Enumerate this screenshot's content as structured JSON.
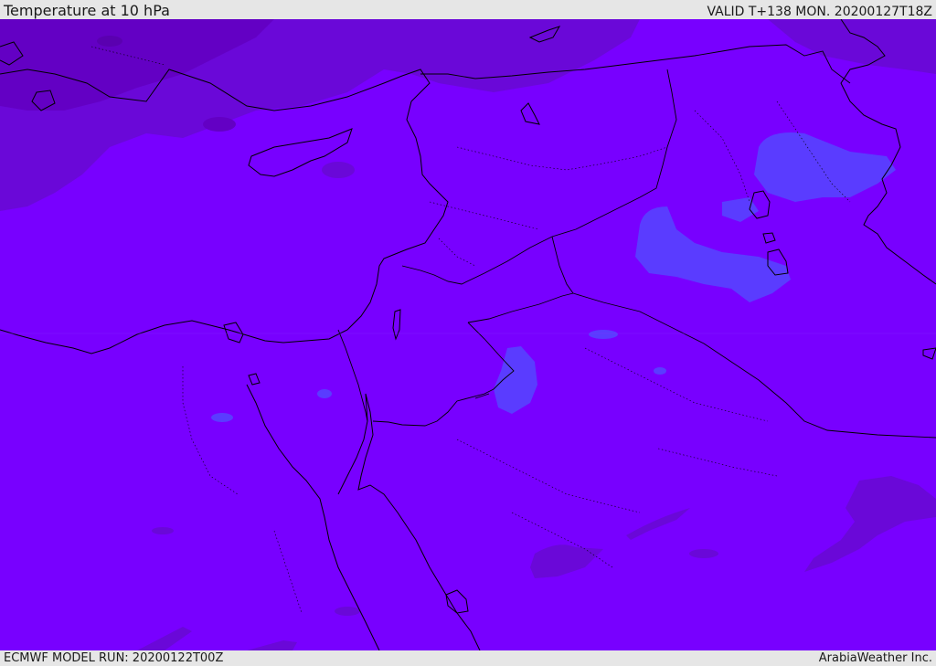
{
  "header": {
    "title": "Temperature at 10 hPa",
    "valid_time": "VALID T+138 MON. 20200127T18Z"
  },
  "footer": {
    "model_run": "ECMWF MODEL RUN: 20200122T00Z",
    "credit": "ArabiaWeather Inc."
  },
  "map": {
    "field": "Temperature",
    "level": "10 hPa",
    "colors": {
      "base_field": "#7800ff",
      "warmer_patch": "#6a08d8",
      "darker_patch": "#6300c4",
      "cooler_patch": "#5a3cff",
      "coastline": "#000000",
      "header_background": "#e6e6e6"
    }
  }
}
